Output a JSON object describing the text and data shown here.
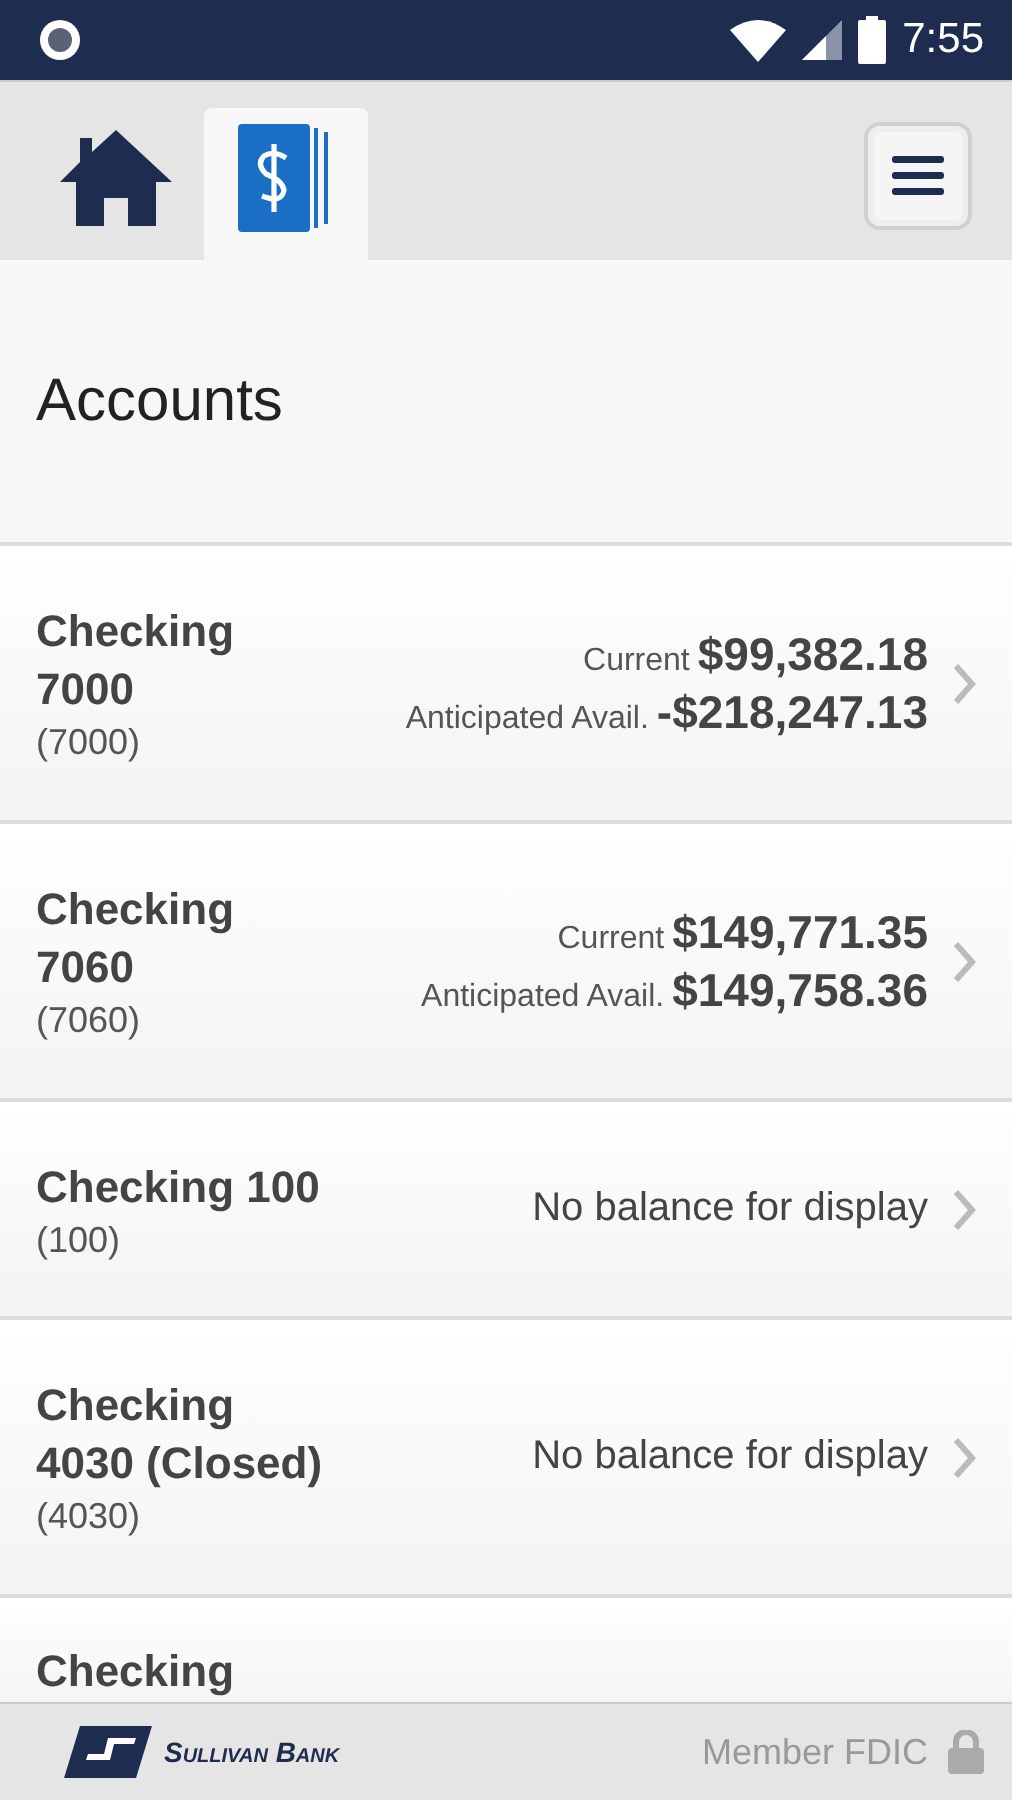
{
  "status_bar": {
    "time": "7:55"
  },
  "tabs": [
    {
      "kind": "home",
      "selected": false
    },
    {
      "kind": "accounts",
      "selected": true
    }
  ],
  "page_title": "Accounts",
  "accounts": [
    {
      "kind": "balances",
      "name": "Checking 7000",
      "number": "(7000)",
      "balances": [
        {
          "label": "Current",
          "amount": "$99,382.18"
        },
        {
          "label": "Anticipated Avail.",
          "amount": "-$218,247.13"
        }
      ]
    },
    {
      "kind": "balances",
      "name": "Checking 7060",
      "number": "(7060)",
      "balances": [
        {
          "label": "Current",
          "amount": "$149,771.35"
        },
        {
          "label": "Anticipated Avail.",
          "amount": "$149,758.36"
        }
      ]
    },
    {
      "kind": "message",
      "name": "Checking 100",
      "number": "(100)",
      "message": "No balance for display"
    },
    {
      "kind": "message",
      "name": "Checking 4030 (Closed)",
      "number": "(4030)",
      "message": "No balance for display"
    },
    {
      "kind": "cut",
      "name": "Checking"
    }
  ],
  "footer": {
    "bank_name": "Sullivan Bank",
    "fdic": "Member FDIC"
  }
}
